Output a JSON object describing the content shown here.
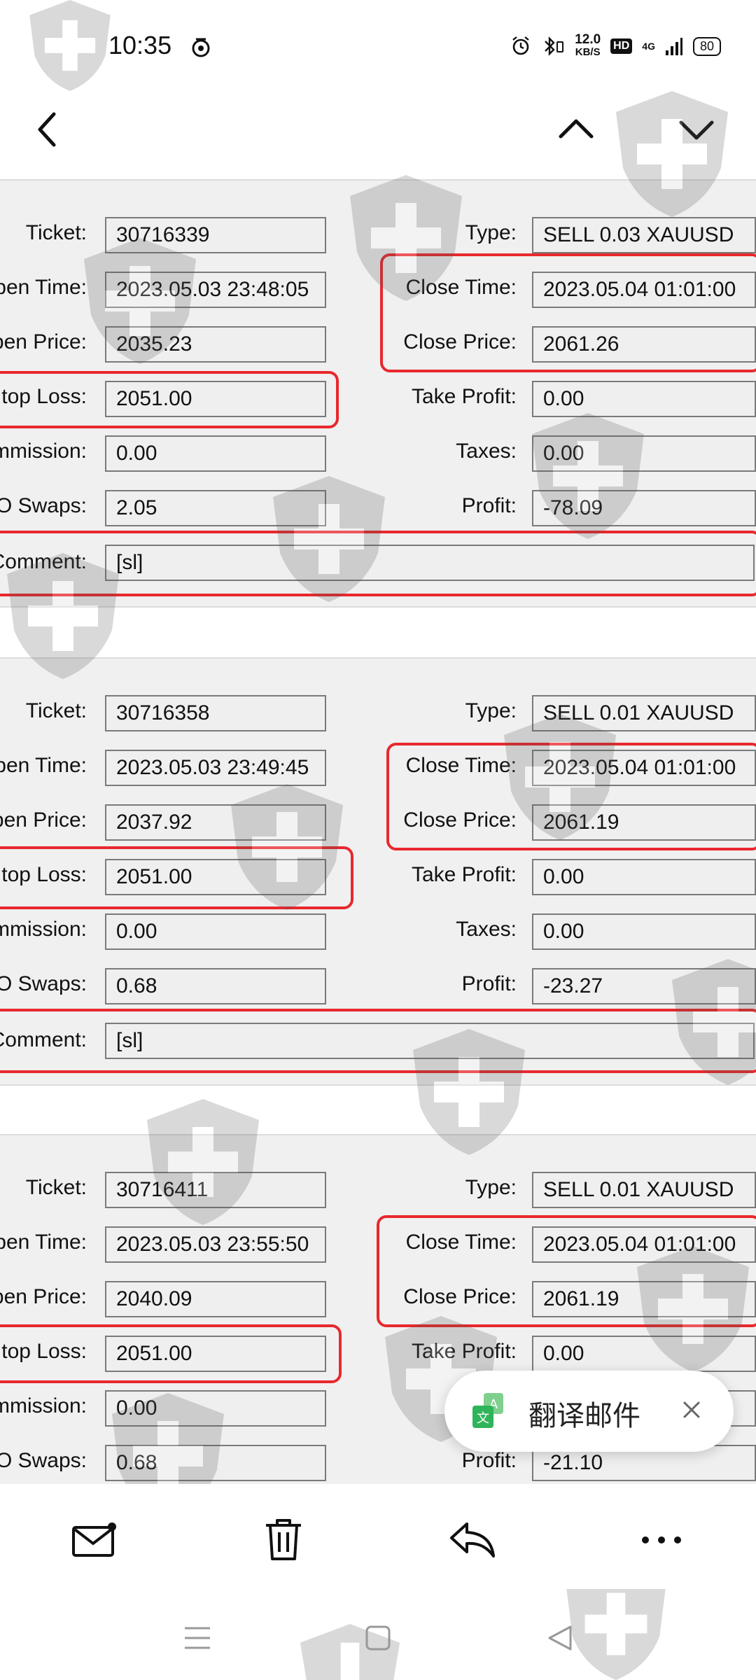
{
  "status_bar": {
    "time": "10:35",
    "net_speed_value": "12.0",
    "net_speed_unit": "KB/S",
    "hd_label": "HD",
    "network_label": "4G",
    "battery": "80"
  },
  "orders": [
    {
      "ticket_label": "Ticket:",
      "ticket": "30716339",
      "type_label": "Type:",
      "type": "SELL 0.03 XAUUSD",
      "open_time_label": "pen Time:",
      "open_time": "2023.05.03 23:48:05",
      "close_time_label": "Close Time:",
      "close_time": "2023.05.04 01:01:00",
      "open_price_label": "pen Price:",
      "open_price": "2035.23",
      "close_price_label": "Close Price:",
      "close_price": "2061.26",
      "stop_loss_label": "top Loss:",
      "stop_loss": "2051.00",
      "take_profit_label": "Take Profit:",
      "take_profit": "0.00",
      "commission_label": "mmission:",
      "commission": "0.00",
      "taxes_label": "Taxes:",
      "taxes": "0.00",
      "swaps_label": "O Swaps:",
      "swaps": "2.05",
      "profit_label": "Profit:",
      "profit": "-78.09",
      "comment_label": "Comment:",
      "comment": "[sl]"
    },
    {
      "ticket_label": "Ticket:",
      "ticket": "30716358",
      "type_label": "Type:",
      "type": "SELL 0.01 XAUUSD",
      "open_time_label": "pen Time:",
      "open_time": "2023.05.03 23:49:45",
      "close_time_label": "Close Time:",
      "close_time": "2023.05.04 01:01:00",
      "open_price_label": "pen Price:",
      "open_price": "2037.92",
      "close_price_label": "Close Price:",
      "close_price": "2061.19",
      "stop_loss_label": "top Loss:",
      "stop_loss": "2051.00",
      "take_profit_label": "Take Profit:",
      "take_profit": "0.00",
      "commission_label": "mmission:",
      "commission": "0.00",
      "taxes_label": "Taxes:",
      "taxes": "0.00",
      "swaps_label": "O Swaps:",
      "swaps": "0.68",
      "profit_label": "Profit:",
      "profit": "-23.27",
      "comment_label": "Comment:",
      "comment": "[sl]"
    },
    {
      "ticket_label": "Ticket:",
      "ticket": "30716411",
      "type_label": "Type:",
      "type": "SELL 0.01 XAUUSD",
      "open_time_label": "pen Time:",
      "open_time": "2023.05.03 23:55:50",
      "close_time_label": "Close Time:",
      "close_time": "2023.05.04 01:01:00",
      "open_price_label": "pen Price:",
      "open_price": "2040.09",
      "close_price_label": "Close Price:",
      "close_price": "2061.19",
      "stop_loss_label": "top Loss:",
      "stop_loss": "2051.00",
      "take_profit_label": "Take Profit:",
      "take_profit": "0.00",
      "commission_label": "mmission:",
      "commission": "0.00",
      "taxes_label": "",
      "taxes": "",
      "swaps_label": "O Swaps:",
      "swaps": "0.68",
      "profit_label": "Profit:",
      "profit": "-21.10",
      "comment_label": "",
      "comment": ""
    }
  ],
  "translate_popup": {
    "label": "翻译邮件",
    "icon": "translate-icon"
  },
  "icons": {
    "back": "chevron-left-icon",
    "prev": "chevron-up-icon",
    "next": "chevron-down-icon",
    "mail": "mail-icon",
    "delete": "trash-icon",
    "reply": "reply-icon",
    "more": "more-icon"
  },
  "colors": {
    "highlight": "#e8282d",
    "panel_bg": "#f0f0f0",
    "field_border": "#7a7a7a",
    "translate_green": "#2fb45a"
  }
}
